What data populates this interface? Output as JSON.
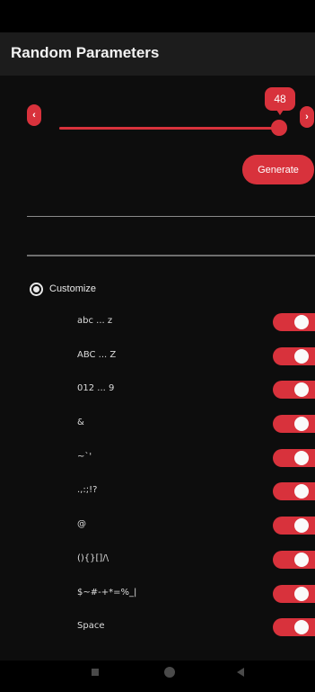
{
  "app": {
    "title": "Random Parameters"
  },
  "length_slider": {
    "value": "48",
    "fraction": 0.98,
    "decrease_glyph": "‹",
    "increase_glyph": "›"
  },
  "generate_button": {
    "label": "Generate"
  },
  "customize": {
    "label": "Customize",
    "selected": true
  },
  "options": [
    {
      "label": "abc ... z",
      "enabled": true
    },
    {
      "label": "ABC ... Z",
      "enabled": true
    },
    {
      "label": "012 ... 9",
      "enabled": true
    },
    {
      "label": "&",
      "enabled": true
    },
    {
      "label": "~`'",
      "enabled": true
    },
    {
      "label": ".,:;!?",
      "enabled": true
    },
    {
      "label": "@",
      "enabled": true
    },
    {
      "label": "(){}[]/\\",
      "enabled": true
    },
    {
      "label": "$~#-+*=%_|",
      "enabled": true
    },
    {
      "label": "Space",
      "enabled": true
    }
  ],
  "colors": {
    "accent": "#d8323c",
    "background": "#0d0d0d",
    "app_bar": "#1c1c1c"
  },
  "icons": {
    "nav_recents": "square-icon",
    "nav_home": "circle-icon",
    "nav_back": "back-triangle-icon"
  }
}
